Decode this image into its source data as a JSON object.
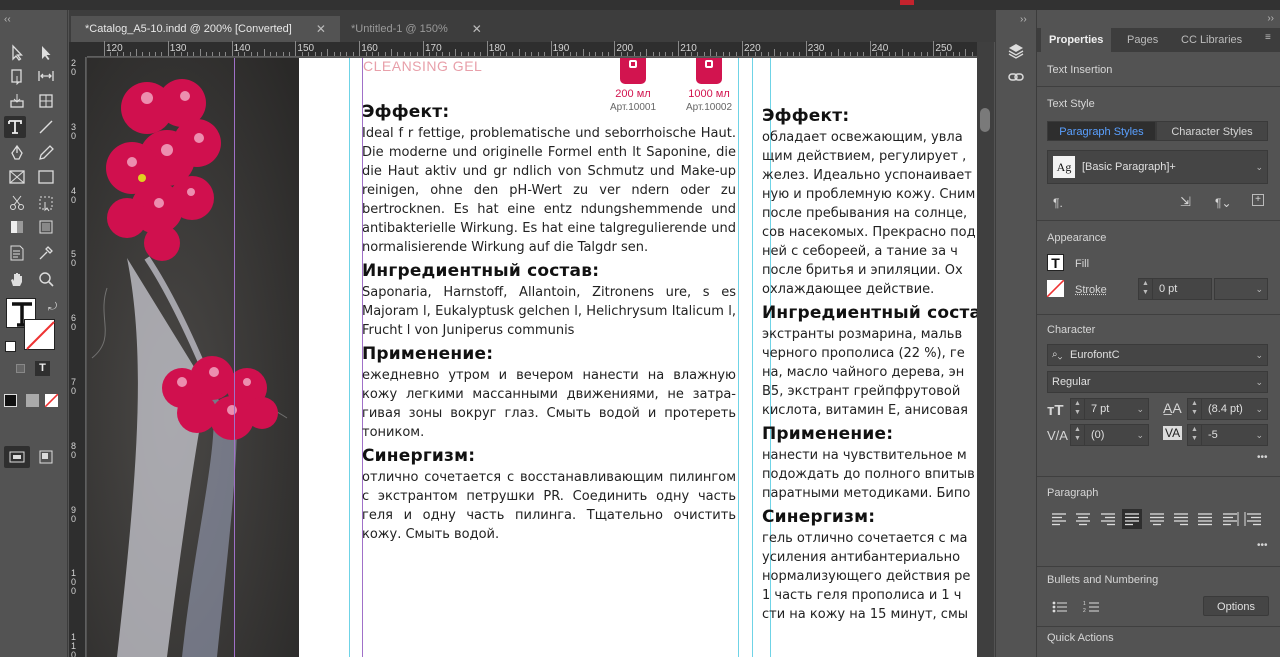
{
  "tabs": [
    {
      "label": "*Catalog_A5-10.indd @ 200% [Converted]",
      "close": "✕",
      "active": true
    },
    {
      "label": "*Untitled-1 @ 150%",
      "close": "✕",
      "active": false
    }
  ],
  "ruler": {
    "h": [
      "120",
      "130",
      "140",
      "150",
      "160",
      "170",
      "180",
      "190",
      "200",
      "210",
      "220",
      "230",
      "240",
      "250"
    ],
    "v": [
      "20",
      "30",
      "40",
      "50",
      "60",
      "70",
      "80",
      "90",
      "100",
      "110"
    ]
  },
  "document": {
    "brand": "CLEANSING GEL",
    "bottle1": {
      "volume": "200 мл",
      "art": "Арт.10001"
    },
    "bottle2": {
      "volume": "1000 мл",
      "art": "Арт.10002"
    },
    "col1": {
      "h_effect": "Эффект:",
      "p_effect": "Ideal f r fettige, problematische und seborrhoische Haut. Die moderne und originelle Formel enth lt Saponine, die die Haut aktiv und gr ndlich von Schmutz und Make-up reinigen, ohne den pH-Wert zu ver ndern oder zu bertrocknen. Es hat eine entz ndungshemmende und antibakterielle Wirkung. Es hat eine talgregulierende und normalisierende Wirkung auf die Talgdr sen.",
      "h_ingr": "Ингредиентный состав:",
      "p_ingr": "Saponaria, Harnstoff, Allantoin, Zitronens ure, s es Majoram l, Eukalyptusk gelchen l, Helichrysum Italicum l, Frucht l von Juniperus communis",
      "h_apply": "Применение:",
      "p_apply": "ежедневно утром и вечером нанести на влажную кожу легкими массанными движениями, не затра-гивая зоны вокруг глаз. Смыть водой и протереть тоником.",
      "h_syn": "Синергизм:",
      "p_syn": "отлично сочетается с восстанавливающим пилингом с экстрантом петрушки PR. Соединить одну часть геля и одну часть пилинга. Тщательно очистить кожу. Смыть водой."
    },
    "col2": {
      "h_effect": "Эффект:",
      "l1": "обладает освежающим, увла",
      "l2": "щим действием, регулирует ,",
      "l3": "желез. Идеально успонаивает",
      "l4": "ную и проблемную кожу. Сним",
      "l5": "после пребывания на солнце,",
      "l6": "сов насекомых. Прекрасно под",
      "l7": "ней с себореей, а тание за ч",
      "l8": "после бритья и эпиляции. Ох",
      "l9": "охлаждающее действие.",
      "h_ingr": "Ингредиентный состав",
      "i1": "экстранты розмарина, мальв",
      "i2": "черного прополиса (22 %), ге",
      "i3": "на, масло чайного дерева, эн",
      "i4": "B5, экстрант грейпфрутовой",
      "i5": "кислота, витамин Е, анисовая",
      "h_apply": "Применение:",
      "a1": "нанести на чувствительное м",
      "a2": "подождать до полного впитыв",
      "a3": "паратными методиками. Бипо",
      "h_syn": "Синергизм:",
      "s1": "гель отлично сочетается с ма",
      "s2": "усиления антибантериально",
      "s3": "нормализующего действия ре",
      "s4": "1 часть геля прополиса и 1 ч",
      "s5": "сти на кожу на 15 минут, смы"
    }
  },
  "panel": {
    "tabs": [
      "Properties",
      "Pages",
      "CC Libraries"
    ],
    "text_insertion": "Text Insertion",
    "text_style": "Text Style",
    "paragraph_styles": "Paragraph Styles",
    "character_styles": "Character Styles",
    "style_value": "[Basic Paragraph]+",
    "style_icon": "Ag",
    "appearance": "Appearance",
    "fill": "Fill",
    "stroke": "Stroke",
    "stroke_value": "0 pt",
    "character": "Character",
    "font": "EurofontC",
    "font_style": "Regular",
    "size": "7 pt",
    "leading": "(8.4 pt)",
    "kerning": "(0)",
    "tracking": "-5",
    "paragraph": "Paragraph",
    "bullets": "Bullets and Numbering",
    "options": "Options",
    "quick_actions": "Quick Actions",
    "more": "•••"
  },
  "colors": {
    "accent_blue": "#2d7fdc",
    "guide_cyan": "#6fd3e6",
    "guide_purple": "#a070c8",
    "brand_red": "#d2144f",
    "highlight": "#f6cfc5"
  }
}
